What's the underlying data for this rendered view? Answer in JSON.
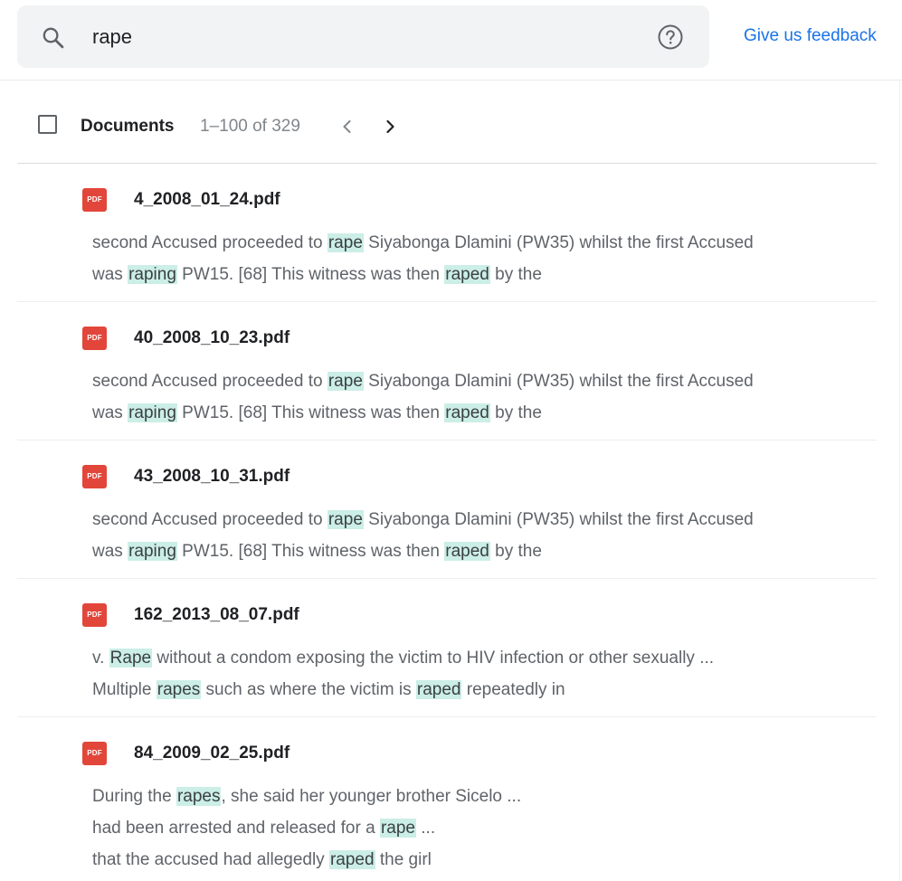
{
  "search": {
    "query": "rape"
  },
  "header": {
    "feedback_label": "Give us feedback"
  },
  "list": {
    "title": "Documents",
    "range": "1–100 of 329"
  },
  "icons": {
    "search": "search-icon",
    "help": "help-circle-icon",
    "prev": "chevron-left-icon",
    "next": "chevron-right-icon",
    "file": "pdf-file-icon"
  },
  "colors": {
    "accent": "#1a73e8",
    "highlight": "#cbeee6",
    "pdf": "#e2463a"
  },
  "results": [
    {
      "icon_label": "PDF",
      "filename": "4_2008_01_24.pdf",
      "lines": [
        [
          [
            "second Accused proceeded to ",
            false
          ],
          [
            "rape",
            true
          ],
          [
            " Siyabonga Dlamini (PW35) whilst the first Accused",
            false
          ]
        ],
        [
          [
            "was ",
            false
          ],
          [
            "raping",
            true
          ],
          [
            " PW15. [68] This witness was then ",
            false
          ],
          [
            "raped",
            true
          ],
          [
            " by the",
            false
          ]
        ]
      ]
    },
    {
      "icon_label": "PDF",
      "filename": "40_2008_10_23.pdf",
      "lines": [
        [
          [
            "second Accused proceeded to ",
            false
          ],
          [
            "rape",
            true
          ],
          [
            " Siyabonga Dlamini (PW35) whilst the first Accused",
            false
          ]
        ],
        [
          [
            "was ",
            false
          ],
          [
            "raping",
            true
          ],
          [
            " PW15. [68] This witness was then ",
            false
          ],
          [
            "raped",
            true
          ],
          [
            " by the",
            false
          ]
        ]
      ]
    },
    {
      "icon_label": "PDF",
      "filename": "43_2008_10_31.pdf",
      "lines": [
        [
          [
            "second Accused proceeded to ",
            false
          ],
          [
            "rape",
            true
          ],
          [
            " Siyabonga Dlamini (PW35) whilst the first Accused",
            false
          ]
        ],
        [
          [
            "was ",
            false
          ],
          [
            "raping",
            true
          ],
          [
            " PW15. [68] This witness was then ",
            false
          ],
          [
            "raped",
            true
          ],
          [
            " by the",
            false
          ]
        ]
      ]
    },
    {
      "icon_label": "PDF",
      "filename": "162_2013_08_07.pdf",
      "lines": [
        [
          [
            "v. ",
            false
          ],
          [
            "Rape",
            true
          ],
          [
            " without a condom exposing the victim to HIV infection or other sexually ...",
            false
          ]
        ],
        [
          [
            "Multiple ",
            false
          ],
          [
            "rapes",
            true
          ],
          [
            " such as where the victim is ",
            false
          ],
          [
            "raped",
            true
          ],
          [
            " repeatedly in",
            false
          ]
        ]
      ]
    },
    {
      "icon_label": "PDF",
      "filename": "84_2009_02_25.pdf",
      "lines": [
        [
          [
            "During the ",
            false
          ],
          [
            "rapes",
            true
          ],
          [
            ", she said her younger brother Sicelo ...",
            false
          ]
        ],
        [
          [
            "had been arrested and released for a ",
            false
          ],
          [
            "rape",
            true
          ],
          [
            " ...",
            false
          ]
        ],
        [
          [
            "that the accused had allegedly ",
            false
          ],
          [
            "raped",
            true
          ],
          [
            " the girl",
            false
          ]
        ]
      ]
    }
  ]
}
